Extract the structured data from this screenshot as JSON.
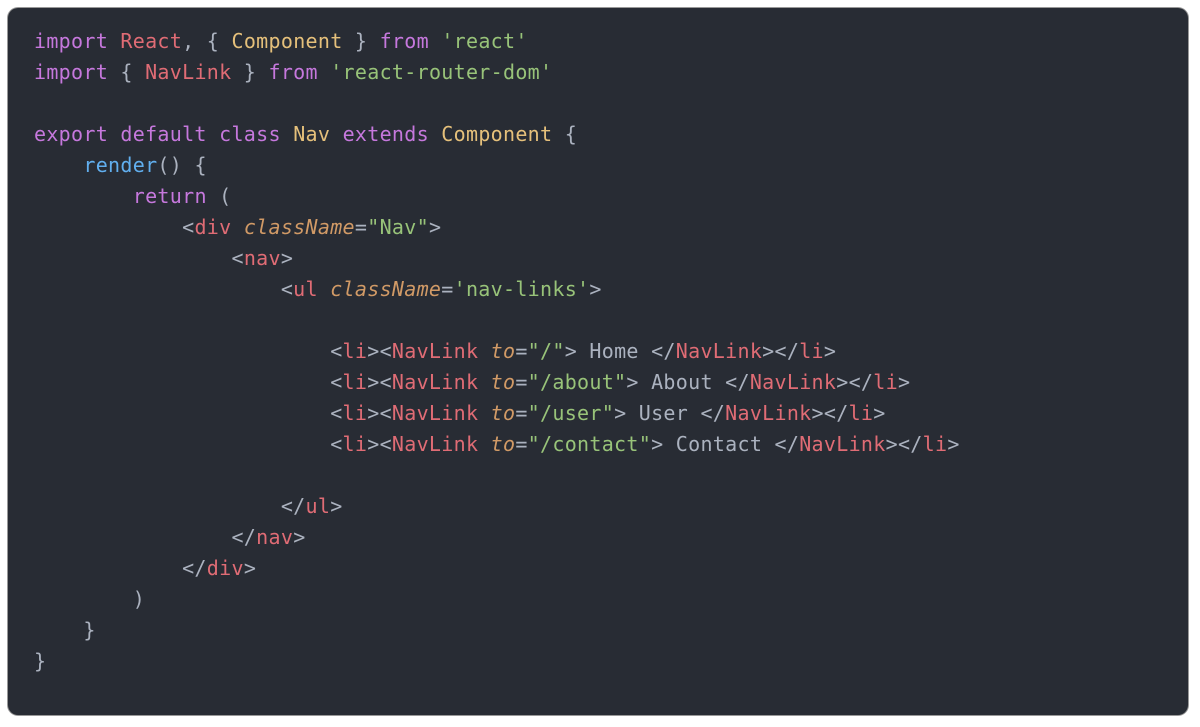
{
  "line1": {
    "import": "import",
    "react": "React",
    "comma": ", ",
    "lbrace": "{ ",
    "component": "Component",
    "rbrace": " }",
    "from": "from",
    "module": "'react'"
  },
  "line2": {
    "import": "import",
    "lbrace": "{ ",
    "navlink": "NavLink",
    "rbrace": " }",
    "from": "from",
    "module": "'react-router-dom'"
  },
  "line4": {
    "export": "export",
    "default": "default",
    "class": "class",
    "nav": "Nav",
    "extends": "extends",
    "component": "Component",
    "lbrace": "{"
  },
  "line5": {
    "indent": "    ",
    "render": "render",
    "paren": "()",
    "lbrace": " {"
  },
  "line6": {
    "indent": "        ",
    "return": "return",
    "lparen": " ("
  },
  "line7": {
    "indent": "            ",
    "lt": "<",
    "div": "div",
    "sp": " ",
    "classNameAttr": "className",
    "eq": "=",
    "val": "\"Nav\"",
    "gt": ">"
  },
  "line8": {
    "indent": "                ",
    "lt": "<",
    "nav": "nav",
    "gt": ">"
  },
  "line9": {
    "indent": "                    ",
    "lt": "<",
    "ul": "ul",
    "sp": " ",
    "classNameAttr": "className",
    "eq": "=",
    "val": "'nav-links'",
    "gt": ">"
  },
  "navitems": [
    {
      "liOpen": "<li>",
      "nlOpen_lt": "<",
      "nlOpen_tag": "NavLink",
      "toAttr": "to",
      "toVal": "\"/\"",
      "text": " Home ",
      "nlClose_lt": "</",
      "nlClose_tag": "NavLink",
      "liClose": "</li>"
    },
    {
      "liOpen": "<li>",
      "nlOpen_lt": "<",
      "nlOpen_tag": "NavLink",
      "toAttr": "to",
      "toVal": "\"/about\"",
      "text": " About ",
      "nlClose_lt": "</",
      "nlClose_tag": "NavLink",
      "liClose": "</li>"
    },
    {
      "liOpen": "<li>",
      "nlOpen_lt": "<",
      "nlOpen_tag": "NavLink",
      "toAttr": "to",
      "toVal": "\"/user\"",
      "text": " User ",
      "nlClose_lt": "</",
      "nlClose_tag": "NavLink",
      "liClose": "</li>"
    },
    {
      "liOpen": "<li>",
      "nlOpen_lt": "<",
      "nlOpen_tag": "NavLink",
      "toAttr": "to",
      "toVal": "\"/contact\"",
      "text": " Contact ",
      "nlClose_lt": "</",
      "nlClose_tag": "NavLink",
      "liClose": "</li>"
    }
  ],
  "navitem_indent": "                        ",
  "line15": {
    "indent": "                    ",
    "close": "</",
    "ul": "ul",
    "gt": ">"
  },
  "line16": {
    "indent": "                ",
    "close": "</",
    "nav": "nav",
    "gt": ">"
  },
  "line17": {
    "indent": "            ",
    "close": "</",
    "div": "div",
    "gt": ">"
  },
  "line18": {
    "indent": "        ",
    "rparen": ")"
  },
  "line19": {
    "indent": "    ",
    "rbrace": "}"
  },
  "line20": {
    "rbrace": "}"
  }
}
